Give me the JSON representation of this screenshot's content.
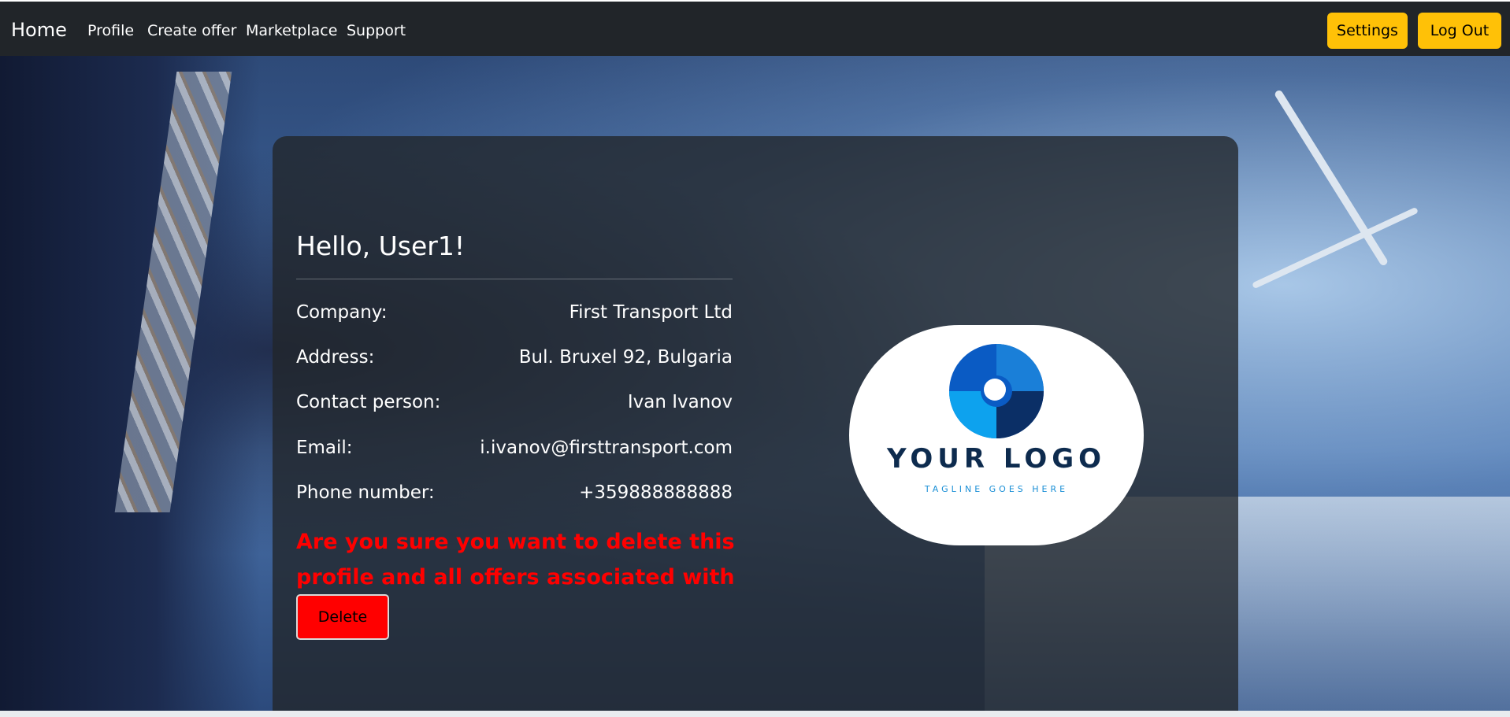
{
  "nav": {
    "brand": "Home",
    "links": [
      "Profile",
      "Create offer",
      "Marketplace",
      "Support"
    ],
    "settings_label": "Settings",
    "logout_label": "Log Out",
    "accent_color": "#ffc107"
  },
  "profile": {
    "greeting": "Hello, User1!",
    "fields": [
      {
        "label": "Company:",
        "value": "First Transport Ltd"
      },
      {
        "label": "Address:",
        "value": "Bul. Bruxel 92, Bulgaria"
      },
      {
        "label": "Contact person:",
        "value": "Ivan Ivanov"
      },
      {
        "label": "Email:",
        "value": "i.ivanov@firsttransport.com"
      },
      {
        "label": "Phone number:",
        "value": "+359888888888"
      }
    ],
    "warning": "Are you sure you want to delete this profile and all offers associated with it?",
    "delete_label": "Delete",
    "danger_color": "#ff0000"
  },
  "logo": {
    "text": "YOUR LOGO",
    "tagline": "TAGLINE GOES HERE"
  }
}
